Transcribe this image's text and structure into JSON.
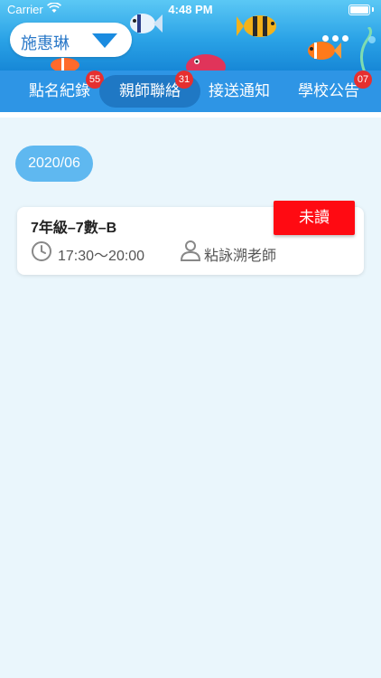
{
  "status_bar": {
    "carrier": "Carrier",
    "time": "4:48 PM"
  },
  "student_selector": {
    "name": "施惠琳"
  },
  "tabs": [
    {
      "label": "點名紀錄",
      "badge": "55",
      "active": false
    },
    {
      "label": "親師聯絡",
      "badge": "31",
      "active": true
    },
    {
      "label": "接送通知",
      "badge": "",
      "active": false
    },
    {
      "label": "學校公告",
      "badge": "07",
      "active": false
    }
  ],
  "month_chip": "2020/06",
  "message_card": {
    "course": "7年級–7數–B",
    "status": "未讀",
    "time": "17:30～20:00",
    "teacher": "粘詠溯老師"
  },
  "colors": {
    "accent": "#2e95e5",
    "active_tab": "#1f78c4",
    "badge": "#e62f2f",
    "unread": "#ff0a12",
    "chip": "#5fb8f0",
    "background": "#eaf6fc"
  },
  "icons": [
    "wifi-icon",
    "battery-icon",
    "chevron-down-icon",
    "clock-icon",
    "person-icon"
  ]
}
